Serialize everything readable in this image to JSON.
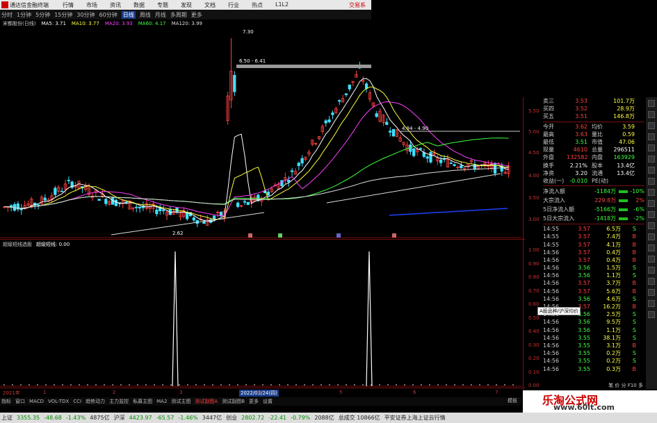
{
  "window": {
    "app_title": "通达信金融终端",
    "menu": [
      "行情",
      "市场",
      "资讯",
      "数据",
      "专题",
      "发现",
      "文档",
      "行业",
      "热点",
      "L1L2"
    ],
    "login": "交易系"
  },
  "toolbar": {
    "periods": [
      "分时",
      "1分钟",
      "5分钟",
      "15分钟",
      "30分钟",
      "60分钟",
      "日线",
      "周线",
      "月线",
      "多周期",
      "更多"
    ],
    "selected": "日线"
  },
  "ma_legend": {
    "stock": "宋都股份(日线)",
    "items": [
      {
        "label": "MA5: 3.71",
        "color": "#ffffff"
      },
      {
        "label": "MA10: 3.77",
        "color": "#ffff40"
      },
      {
        "label": "MA20: 3.93",
        "color": "#ff40ff"
      },
      {
        "label": "MA60: 4.17",
        "color": "#40ff40"
      },
      {
        "label": "MA120: 3.99",
        "color": "#dddddd"
      }
    ]
  },
  "chart_annotations": {
    "high": "7.30",
    "range1": "6.50 - 6.41",
    "range2": "4.94 - 4.90",
    "low": "2.62"
  },
  "price_axis": [
    "5.50",
    "5.00",
    "4.50",
    "4.00",
    "3.50",
    "3.00"
  ],
  "sub_axis": [
    "1.00",
    "0.90",
    "0.80",
    "0.70",
    "0.60",
    "0.50",
    "0.40",
    "0.30",
    "0.20",
    "0.10",
    "0.00"
  ],
  "sub_legend": {
    "name": "超级短线选股",
    "item": "超级短线: 0.00"
  },
  "date_bar": {
    "start": "2021年",
    "mid": "2022/03/24(四)",
    "nums": [
      "1",
      "2",
      "3",
      "4",
      "5",
      "6",
      "7"
    ]
  },
  "quote": {
    "asks": [
      {
        "label": "卖三",
        "price": "3.53",
        "vol": "101.7万"
      },
      {
        "label": "买四",
        "price": "3.52",
        "vol": "28.9万"
      },
      {
        "label": "买五",
        "price": "3.51",
        "vol": "146.8万"
      }
    ],
    "stats": [
      {
        "l1": "今开",
        "v1": "3.62",
        "l2": "均价",
        "v2": "3.59"
      },
      {
        "l1": "最高",
        "v1": "3.63",
        "l2": "量比",
        "v2": "0.59"
      },
      {
        "l1": "最低",
        "v1": "3.51",
        "l2": "市值",
        "v2": "47.06"
      },
      {
        "l1": "现量",
        "v1": "4610",
        "l2": "总量",
        "v2": "296511"
      },
      {
        "l1": "外盘",
        "v1": "132582",
        "l2": "内盘",
        "v2": "163929"
      },
      {
        "l1": "换手",
        "v1": "2.21%",
        "l2": "股本",
        "v2": "13.4亿"
      },
      {
        "l1": "净资",
        "v1": "3.20",
        "l2": "流通",
        "v2": "13.4亿"
      },
      {
        "l1": "收益(一)",
        "v1": "-0.010",
        "l2": "PE(动)",
        "v2": ""
      }
    ],
    "funds": [
      {
        "name": "净流入额",
        "val": "-1184万",
        "pct": "-10%"
      },
      {
        "name": "大宗流入",
        "val": "229.8万",
        "pct": "2%"
      },
      {
        "name": "5日净流入额",
        "val": "-5166万",
        "pct": "-6%"
      },
      {
        "name": "5日大宗流入",
        "val": "-1418万",
        "pct": "-2%"
      }
    ],
    "ticks": [
      {
        "t": "14:55",
        "p": "3.57",
        "v": "6.5万",
        "s": "S"
      },
      {
        "t": "14:55",
        "p": "3.57",
        "v": "7.4万",
        "s": "B"
      },
      {
        "t": "14:55",
        "p": "3.57",
        "v": "4.1万",
        "s": "B"
      },
      {
        "t": "14:56",
        "p": "3.57",
        "v": "0.4万",
        "s": "B"
      },
      {
        "t": "14:56",
        "p": "3.57",
        "v": "0.4万",
        "s": "B"
      },
      {
        "t": "14:56",
        "p": "3.56",
        "v": "1.5万",
        "s": "S"
      },
      {
        "t": "14:56",
        "p": "3.56",
        "v": "1.1万",
        "s": "S"
      },
      {
        "t": "14:56",
        "p": "3.57",
        "v": "3.7万",
        "s": "B"
      },
      {
        "t": "14:56",
        "p": "3.57",
        "v": "5.6万",
        "s": "B"
      },
      {
        "t": "14:56",
        "p": "3.56",
        "v": "4.6万",
        "s": "S"
      },
      {
        "t": "14:56",
        "p": "3.57",
        "v": "16.2万",
        "s": "B"
      },
      {
        "t": "14:56",
        "p": "3.56",
        "v": "2.5万",
        "s": "S"
      },
      {
        "t": "14:56",
        "p": "3.56",
        "v": "9.5万",
        "s": "S"
      },
      {
        "t": "14:56",
        "p": "3.56",
        "v": "1.1万",
        "s": "S"
      },
      {
        "t": "14:56",
        "p": "3.55",
        "v": "38.1万",
        "s": "S"
      },
      {
        "t": "14:56",
        "p": "3.55",
        "v": "3.1万",
        "s": "B"
      },
      {
        "t": "14:56",
        "p": "3.55",
        "v": "0.2万",
        "s": "S"
      },
      {
        "t": "14:56",
        "p": "3.55",
        "v": "0.2万",
        "s": "S"
      },
      {
        "t": "14:56",
        "p": "3.55",
        "v": "0.3万",
        "s": "B"
      }
    ],
    "tooltip": "A股品种/沪深均价",
    "footer": "笔 价 分 F10 多"
  },
  "bottom_tabs": [
    "指标",
    "窗口",
    "MACD",
    "VOL-TDX",
    "CCI",
    "趋势动力",
    "主力监控",
    "私募主图",
    "MA2",
    "测试主图",
    "测试副图A",
    "测试副图B",
    "更多",
    "设置"
  ],
  "bottom_selected": "测试副图A",
  "template_label": "模板",
  "status": {
    "items": [
      {
        "label": "上证",
        "value": "3355.35",
        "c1": "-48.68",
        "c2": "-1.43%",
        "c3": "4875亿"
      },
      {
        "label": "沪深",
        "value": "4423.97",
        "c1": "-65.57",
        "c2": "-1.46%",
        "c3": "3447亿"
      },
      {
        "label": "创业",
        "value": "2802.72",
        "c1": "-22.41",
        "c2": "-0.79%",
        "c3": "2088亿"
      }
    ],
    "extra": "总成交 10866亿",
    "broker": "平安证券上海上证云行情"
  },
  "watermark": {
    "line1": "乐淘公式网",
    "line2": "www.60lt.com"
  },
  "colors": {
    "up": "#ff4040",
    "down": "#40e0ff",
    "ma5": "#ffffff",
    "ma10": "#ffff40",
    "ma20": "#ff40ff",
    "ma60": "#40ff40",
    "ma120": "#dddddd"
  }
}
